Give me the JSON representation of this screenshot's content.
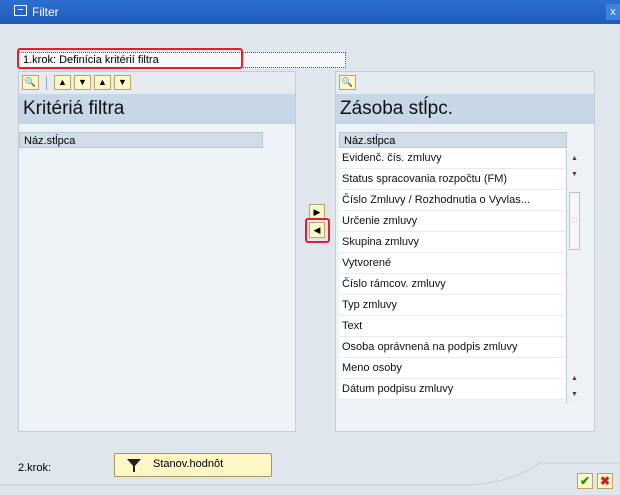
{
  "window": {
    "title": "Filter",
    "close_label": "x"
  },
  "step1": {
    "label": "1.krok: Definícia kritérií filtra"
  },
  "left_panel": {
    "title": "Kritériá filtra",
    "column_header": "Náz.stĺpca",
    "toolbar_icons": [
      "binoculars-icon",
      "arrow-up-icon",
      "arrow-down-icon",
      "arrow-top-icon",
      "arrow-bottom-icon"
    ]
  },
  "right_panel": {
    "title": "Zásoba stĺpc.",
    "column_header": "Náz.stĺpca",
    "items": [
      "Evidenč. čís. zmluvy",
      "Status spracovania rozpočtu (FM)",
      "Číslo Zmluvy / Rozhodnutia o Vyvlas...",
      "Určenie zmluvy",
      "Skupina zmluvy",
      "Vytvorené",
      "Číslo rámcov. zmluvy",
      "Typ zmluvy",
      "Text",
      "Osoba oprávnená na podpis zmluvy",
      "Meno osoby",
      "Dátum podpisu zmluvy"
    ]
  },
  "move": {
    "right_icon": "arrow-right-icon",
    "left_icon": "arrow-left-icon"
  },
  "step2": {
    "label": "2.krok:",
    "button_label": "Stanov.hodnôt"
  },
  "footer": {
    "ok_icon": "checkmark-icon",
    "cancel_icon": "cancel-icon"
  },
  "colors": {
    "titlebar": "#1f5bb8",
    "background": "#dfe6ee",
    "button": "#fff7c6",
    "highlight": "#e0202a"
  }
}
